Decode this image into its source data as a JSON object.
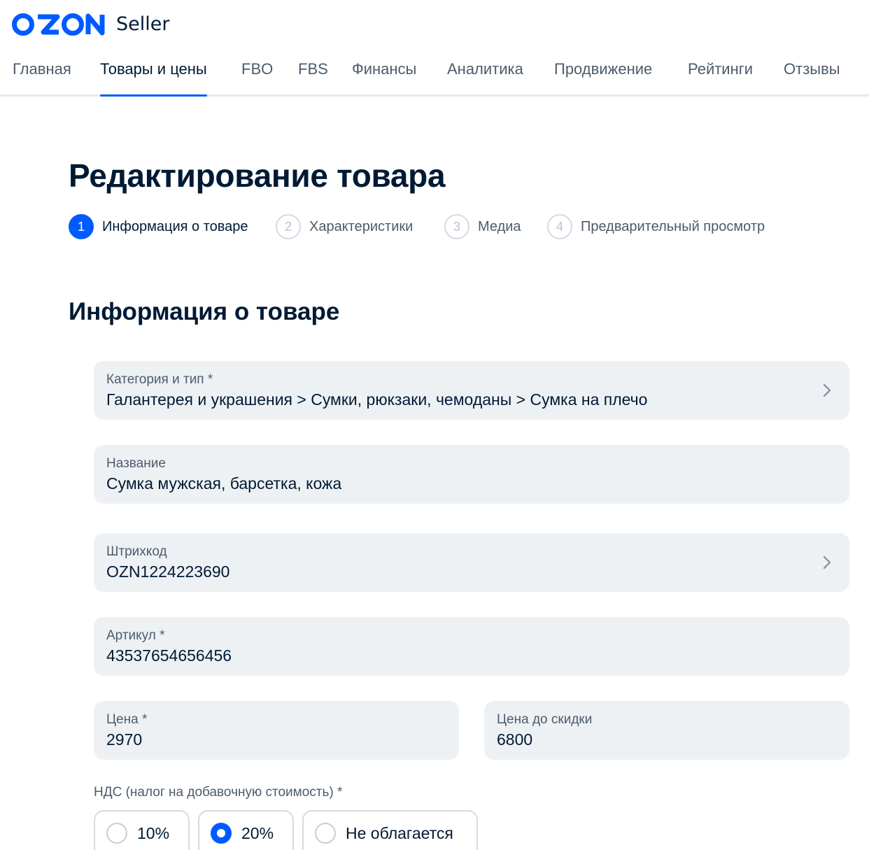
{
  "brand": {
    "logo_text": "OZON",
    "product": "Seller",
    "logo_color": "#005bff"
  },
  "nav": {
    "items": [
      {
        "label": "Главная"
      },
      {
        "label": "Товары и цены"
      },
      {
        "label": "FBO"
      },
      {
        "label": "FBS"
      },
      {
        "label": "Финансы"
      },
      {
        "label": "Аналитика"
      },
      {
        "label": "Продвижение"
      },
      {
        "label": "Рейтинги"
      },
      {
        "label": "Отзывы"
      }
    ],
    "active": "Товары и цены"
  },
  "page": {
    "title": "Редактирование товара"
  },
  "steps": [
    {
      "number": "1",
      "label": "Информация о товаре",
      "active": true
    },
    {
      "number": "2",
      "label": "Характеристики",
      "active": false
    },
    {
      "number": "3",
      "label": "Медиа",
      "active": false
    },
    {
      "number": "4",
      "label": "Предварительный просмотр",
      "active": false
    }
  ],
  "section": {
    "title": "Информация о товаре"
  },
  "fields": {
    "category": {
      "label": "Категория и тип *",
      "value": "Галантерея и украшения > Сумки, рюкзаки, чемоданы > Сумка на плечо",
      "icon": "chevron-right-icon"
    },
    "name": {
      "label": "Название",
      "value": "Сумка мужская, барсетка, кожа"
    },
    "barcode": {
      "label": "Штрихкод",
      "value": "OZN1224223690",
      "icon": "chevron-right-icon"
    },
    "article": {
      "label": "Артикул *",
      "value": "43537654656456"
    },
    "price": {
      "label": "Цена *",
      "value": "2970"
    },
    "old_price": {
      "label": "Цена до скидки",
      "value": "6800"
    }
  },
  "vat": {
    "label": "НДС (налог на добавочную стоимость) *",
    "options": [
      {
        "label": "10%",
        "checked": false
      },
      {
        "label": "20%",
        "checked": true
      },
      {
        "label": "Не облагается",
        "checked": false
      }
    ]
  },
  "colors": {
    "accent": "#005bff",
    "text_primary": "#001a34",
    "text_secondary": "#4d5b6b",
    "field_bg": "#eef1f4"
  }
}
